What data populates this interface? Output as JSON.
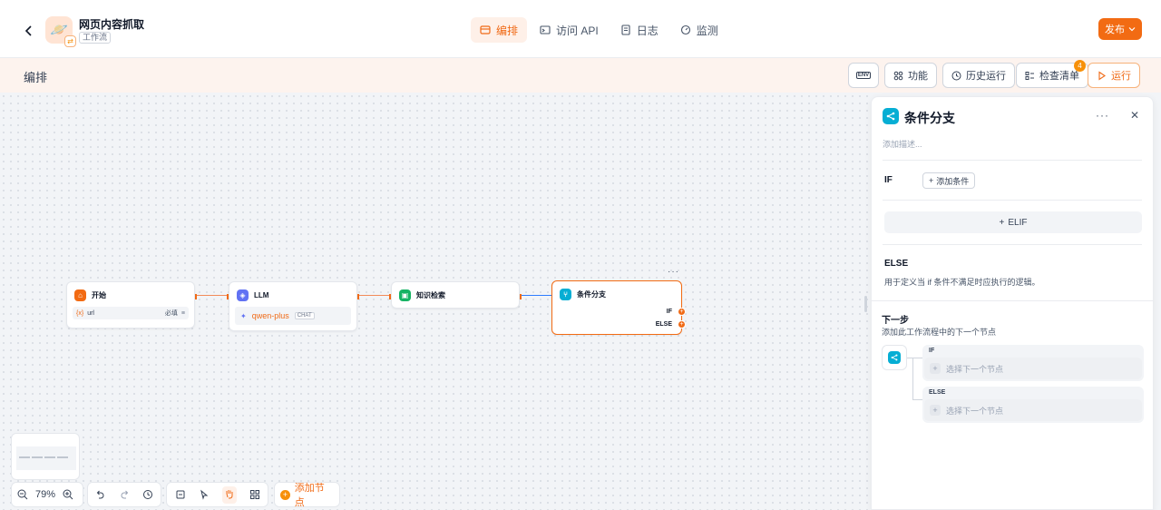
{
  "header": {
    "back_icon": "chevron-left-icon",
    "app_icon": "planet-emoji-icon",
    "app_title": "网页内容抓取",
    "app_type": "工作流",
    "tabs": [
      {
        "label": "编排",
        "icon": "layout-icon",
        "active": true
      },
      {
        "label": "访问 API",
        "icon": "terminal-icon",
        "active": false
      },
      {
        "label": "日志",
        "icon": "document-icon",
        "active": false
      },
      {
        "label": "监测",
        "icon": "gauge-icon",
        "active": false
      }
    ],
    "publish_label": "发布"
  },
  "subbar": {
    "title": "编排",
    "env_label": "ENV",
    "features_label": "功能",
    "history_label": "历史运行",
    "checklist_label": "检查清单",
    "checklist_count": "4",
    "run_label": "运行"
  },
  "canvas": {
    "nodes": {
      "start": {
        "title": "开始",
        "var_prefix": "{x}",
        "var_name": "url",
        "var_required": "必填"
      },
      "llm": {
        "title": "LLM",
        "model": "qwen-plus",
        "model_tag": "CHAT"
      },
      "knowledge": {
        "title": "知识检索"
      },
      "ifelse": {
        "title": "条件分支",
        "branch_if": "IF",
        "branch_else": "ELSE"
      }
    },
    "node_more": "···",
    "zoom_label": "79%",
    "add_node_label": "添加节点"
  },
  "panel": {
    "title": "条件分支",
    "more": "···",
    "close": "✕",
    "description_placeholder": "添加描述...",
    "if_label": "IF",
    "add_condition_label": "添加条件",
    "elif_label": "ELIF",
    "else_label": "ELSE",
    "else_description": "用于定义当 if 条件不满足时应执行的逻辑。",
    "next_step_title": "下一步",
    "next_step_description": "添加此工作流程中的下一个节点",
    "branches": [
      {
        "label": "IF",
        "placeholder": "选择下一个节点"
      },
      {
        "label": "ELSE",
        "placeholder": "选择下一个节点"
      }
    ]
  },
  "colors": {
    "accent": "#f26b13",
    "ifelse": "#06aed4",
    "llm": "#6172f3",
    "knowledge": "#16b364",
    "start": "#f26b13"
  }
}
